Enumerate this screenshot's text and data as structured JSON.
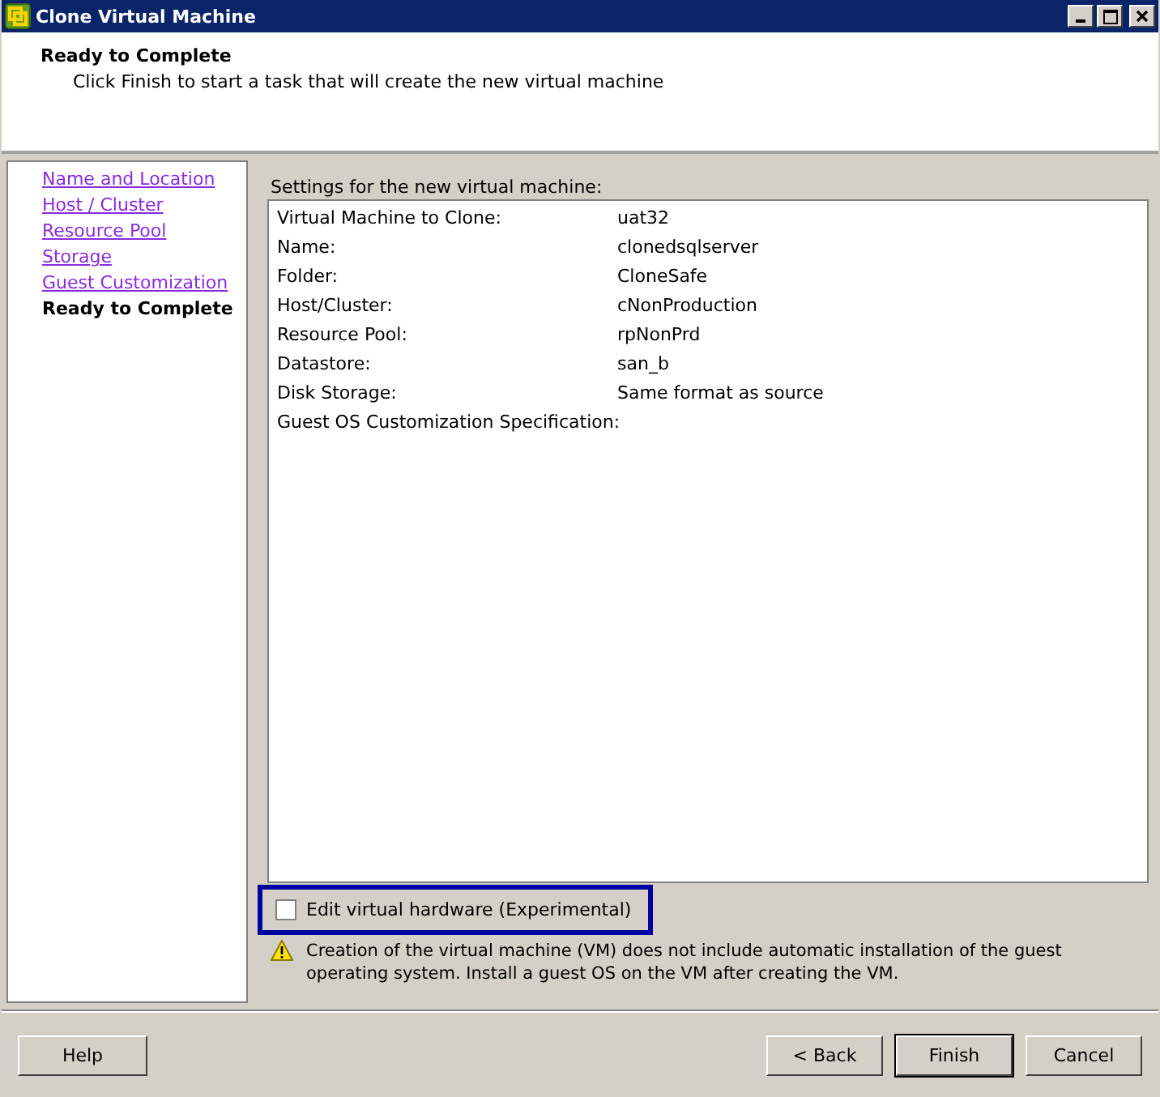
{
  "window": {
    "title": "Clone Virtual Machine"
  },
  "header": {
    "title": "Ready to Complete",
    "subtitle": "Click Finish to start a task that will create the new virtual machine"
  },
  "steps": [
    {
      "label": "Name and Location",
      "selected": false
    },
    {
      "label": "Host / Cluster",
      "selected": false
    },
    {
      "label": "Resource Pool",
      "selected": false
    },
    {
      "label": "Storage",
      "selected": false
    },
    {
      "label": "Guest Customization",
      "selected": false
    },
    {
      "label": "Ready to Complete",
      "selected": true
    }
  ],
  "settings": {
    "caption": "Settings for the new virtual machine:",
    "rows": [
      {
        "label": "Virtual Machine to Clone:",
        "value": "uat32"
      },
      {
        "label": "Name:",
        "value": "clonedsqlserver"
      },
      {
        "label": "Folder:",
        "value": "CloneSafe"
      },
      {
        "label": "Host/Cluster:",
        "value": "cNonProduction"
      },
      {
        "label": "Resource Pool:",
        "value": "rpNonPrd"
      },
      {
        "label": "Datastore:",
        "value": "san_b"
      },
      {
        "label": "Disk Storage:",
        "value": "Same format as source"
      },
      {
        "label": "Guest OS Customization Specification:"
      }
    ]
  },
  "edit_hardware": {
    "label": "Edit virtual hardware (Experimental)",
    "checked": false,
    "highlighted": true
  },
  "warning": "Creation of the virtual machine (VM) does not include automatic installation of the guest operating system. Install a guest OS on the VM after creating the VM.",
  "buttons": {
    "left": [
      "Help"
    ],
    "right": [
      {
        "label": "< Back",
        "default": false
      },
      {
        "label": "Finish",
        "default": true
      },
      {
        "label": "Cancel",
        "default": false
      }
    ]
  }
}
